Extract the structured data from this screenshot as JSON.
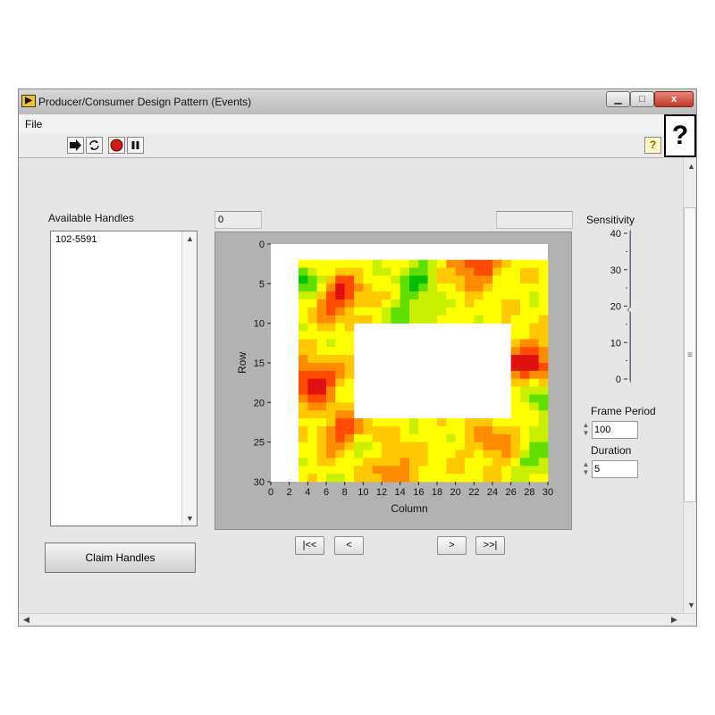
{
  "window": {
    "title": "Producer/Consumer Design Pattern (Events)",
    "close_glyph": "x"
  },
  "menu": {
    "file": "File"
  },
  "toolbar": {
    "help_glyph": "?"
  },
  "help_panel": {
    "glyph": "?"
  },
  "handles": {
    "label": "Available Handles",
    "items": [
      "102-5591"
    ]
  },
  "claim_button": {
    "label": "Claim Handles"
  },
  "frame_indicator": {
    "value": "0"
  },
  "status_indicator": {
    "value": ""
  },
  "graph": {
    "xlabel": "Column",
    "ylabel": "Row",
    "xticks": [
      "0",
      "2",
      "4",
      "6",
      "8",
      "10",
      "12",
      "14",
      "16",
      "18",
      "20",
      "22",
      "24",
      "26",
      "28",
      "30"
    ],
    "yticks": [
      "0",
      "5",
      "10",
      "15",
      "20",
      "25",
      "30"
    ]
  },
  "navigation": {
    "first": "|<<",
    "prev": "<",
    "next": ">",
    "last": ">>|"
  },
  "sensitivity": {
    "label": "Sensitivity",
    "ticks": [
      "40",
      "30",
      "20",
      "10",
      "0"
    ],
    "value": 19,
    "min": 0,
    "max": 40
  },
  "frame_period": {
    "label": "Frame Period",
    "value": "100"
  },
  "duration": {
    "label": "Duration",
    "value": "5"
  },
  "chart_data": {
    "type": "heatmap",
    "xlabel": "Column",
    "ylabel": "Row",
    "xlim": [
      0,
      30
    ],
    "ylim": [
      30,
      0
    ],
    "colormap": [
      "#00c000",
      "#60e000",
      "#c8f000",
      "#ffff00",
      "#ffc800",
      "#ff8c00",
      "#ff4a00",
      "#e01010"
    ],
    "data_columns": [
      3,
      30
    ],
    "data_rows": [
      2,
      30
    ],
    "blank_region": {
      "columns": [
        9,
        26
      ],
      "rows": [
        10,
        22
      ]
    },
    "hotspots": [
      {
        "column": 7,
        "row": 6.5,
        "intensity": 0.95
      },
      {
        "column": 4.5,
        "row": 17.5,
        "intensity": 1.0
      },
      {
        "column": 8,
        "row": 24,
        "intensity": 0.85
      },
      {
        "column": 22,
        "row": 2.5,
        "intensity": 0.9
      },
      {
        "column": 28,
        "row": 15,
        "intensity": 0.95
      },
      {
        "column": 24,
        "row": 25,
        "intensity": 0.7
      },
      {
        "column": 13,
        "row": 28,
        "intensity": 0.75
      }
    ],
    "coldspots": [
      {
        "column": 4,
        "row": 5,
        "intensity": 0.0
      },
      {
        "column": 16,
        "row": 4,
        "intensity": 0.1
      },
      {
        "column": 10,
        "row": 26,
        "intensity": 0.2
      },
      {
        "column": 29,
        "row": 27,
        "intensity": 0.15
      },
      {
        "column": 15,
        "row": 9,
        "intensity": 0.15
      },
      {
        "column": 30,
        "row": 20,
        "intensity": 0.05
      }
    ]
  }
}
